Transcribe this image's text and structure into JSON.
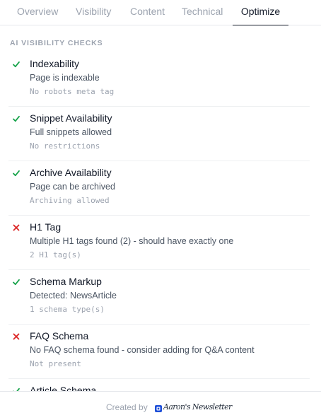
{
  "tabs": [
    {
      "label": "Overview",
      "active": false
    },
    {
      "label": "Visibility",
      "active": false
    },
    {
      "label": "Content",
      "active": false
    },
    {
      "label": "Technical",
      "active": false
    },
    {
      "label": "Optimize",
      "active": true
    }
  ],
  "section": {
    "heading": "AI VISIBILITY CHECKS",
    "checks": [
      {
        "title": "Indexability",
        "detail": "Page is indexable",
        "note": "No robots meta tag",
        "status": "pass"
      },
      {
        "title": "Snippet Availability",
        "detail": "Full snippets allowed",
        "note": "No restrictions",
        "status": "pass"
      },
      {
        "title": "Archive Availability",
        "detail": "Page can be archived",
        "note": "Archiving allowed",
        "status": "pass"
      },
      {
        "title": "H1 Tag",
        "detail": "Multiple H1 tags found (2) - should have exactly one",
        "note": "2 H1 tag(s)",
        "status": "fail"
      },
      {
        "title": "Schema Markup",
        "detail": "Detected: NewsArticle",
        "note": "1 schema type(s)",
        "status": "pass"
      },
      {
        "title": "FAQ Schema",
        "detail": "No FAQ schema found - consider adding for Q&A content",
        "note": "Not present",
        "status": "fail"
      },
      {
        "title": "Article Schema",
        "detail": "",
        "note": "",
        "status": "pass"
      }
    ]
  },
  "footer": {
    "created_by": "Created by",
    "brand_name": "Aaron's Newsletter"
  },
  "colors": {
    "pass": "#16a34a",
    "fail": "#dc2626",
    "brand": "#1d4ed8"
  },
  "icons": {
    "pass": "checkmark-icon",
    "fail": "x-mark-icon",
    "brand": "newsletter-logo-icon"
  }
}
